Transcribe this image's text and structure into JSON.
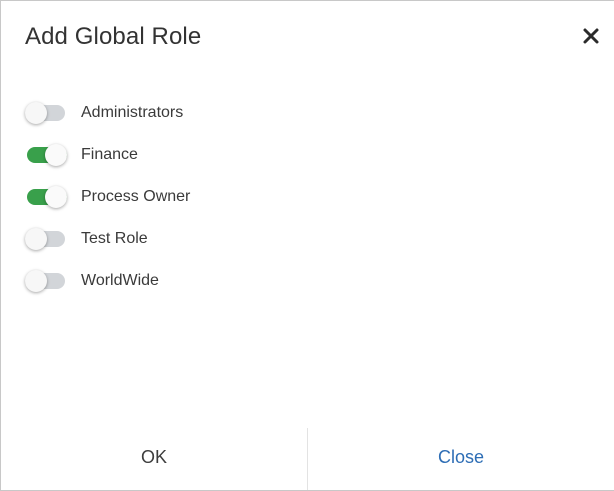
{
  "dialog": {
    "title": "Add Global Role",
    "close_icon": "close-icon",
    "roles": [
      {
        "label": "Administrators",
        "enabled": false
      },
      {
        "label": "Finance",
        "enabled": true
      },
      {
        "label": "Process Owner",
        "enabled": true
      },
      {
        "label": "Test Role",
        "enabled": false
      },
      {
        "label": "WorldWide",
        "enabled": false
      }
    ],
    "ok_label": "OK",
    "close_label": "Close"
  },
  "colors": {
    "toggle_on": "#39a04b",
    "toggle_off": "#d2d5d9",
    "close_button_text": "#2d6db5"
  }
}
